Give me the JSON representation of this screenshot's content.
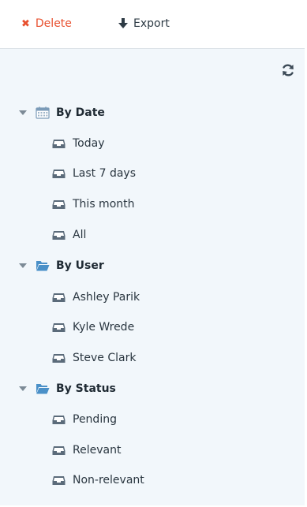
{
  "toolbar": {
    "delete_label": "Delete",
    "export_label": "Export"
  },
  "icons": {
    "delete": "close-icon",
    "export": "arrow-down-icon",
    "refresh": "refresh-icon",
    "date_group": "calendar-icon",
    "folder_group": "folder-open-icon",
    "leaf": "inbox-icon",
    "caret": "caret-down-icon"
  },
  "colors": {
    "delete": "#e8502f",
    "panel_bg": "#f2f7fb",
    "icon_blue": "#4a90c8",
    "leaf_icon": "#5b6b7a"
  },
  "tree": {
    "by_date": {
      "label": "By Date",
      "items": [
        "Today",
        "Last 7 days",
        "This month",
        "All"
      ]
    },
    "by_user": {
      "label": "By User",
      "items": [
        "Ashley Parik",
        "Kyle Wrede",
        "Steve Clark"
      ]
    },
    "by_status": {
      "label": "By Status",
      "items": [
        "Pending",
        "Relevant",
        "Non-relevant"
      ]
    }
  }
}
